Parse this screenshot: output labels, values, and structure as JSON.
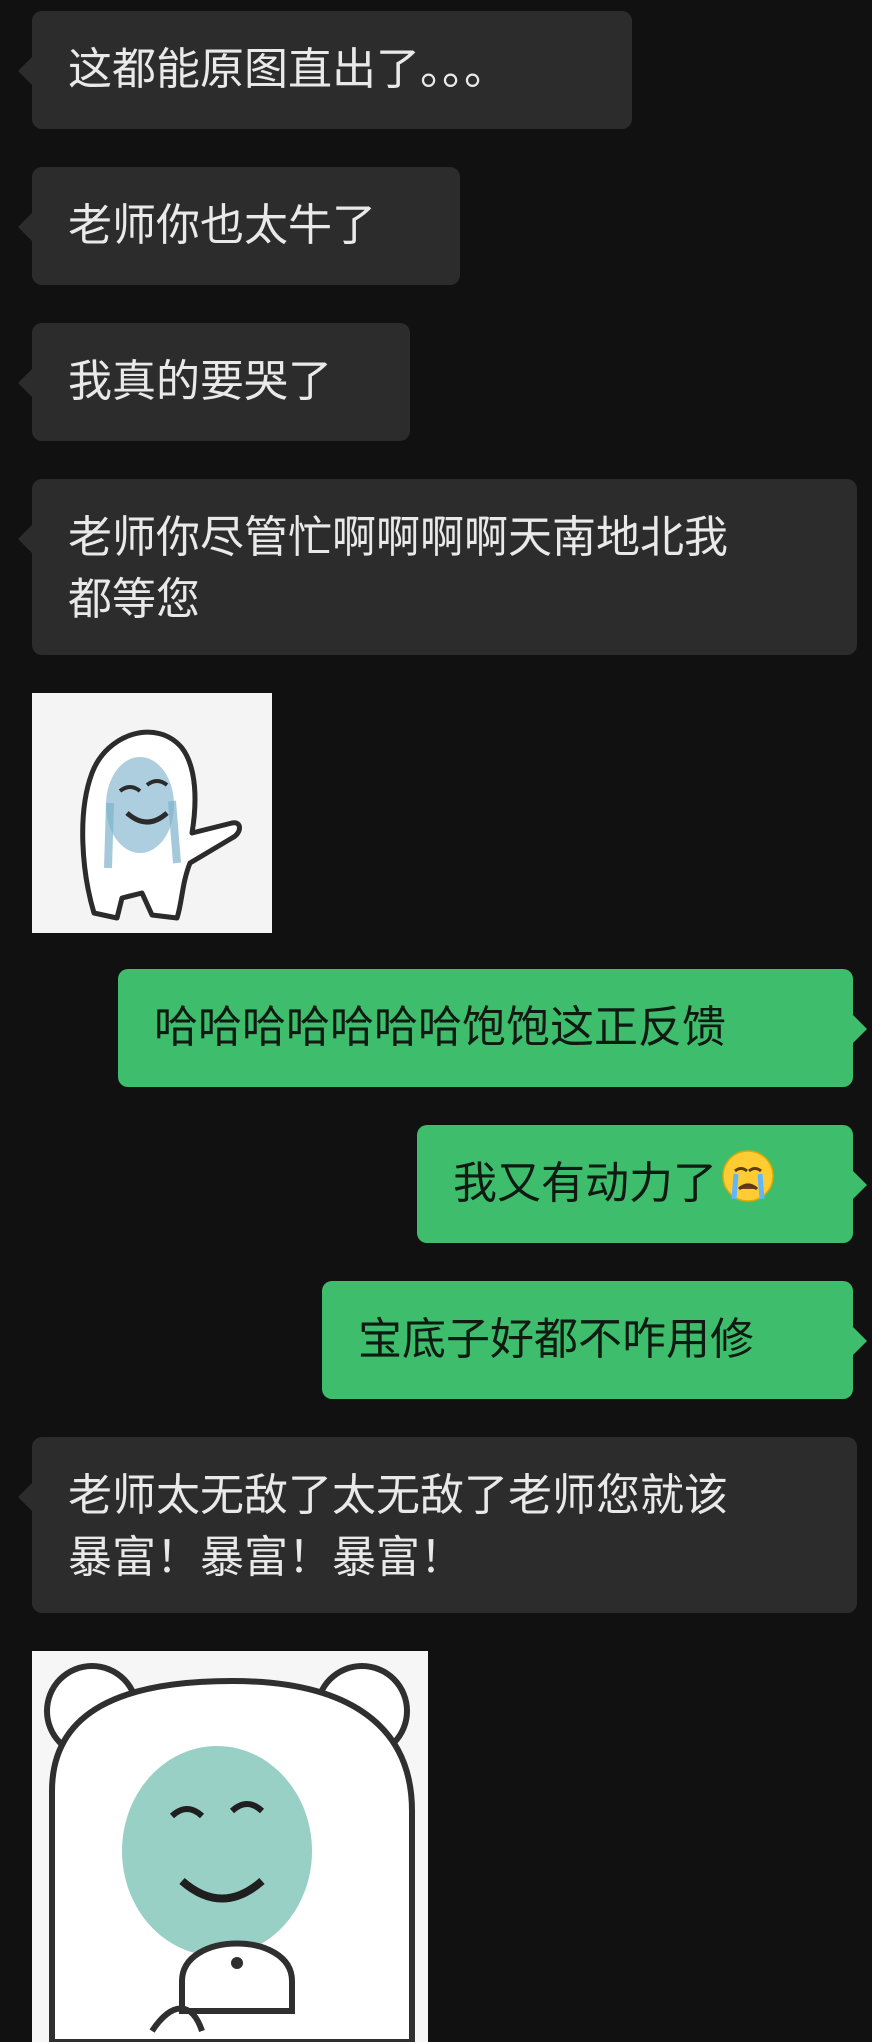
{
  "messages": [
    {
      "side": "left",
      "text": "这都能原图直出了。。。"
    },
    {
      "side": "left",
      "text": "老师你也太牛了"
    },
    {
      "side": "left",
      "text": "我真的要哭了"
    },
    {
      "side": "left",
      "line1": "老师你尽管忙啊啊啊啊天南地北我",
      "line2": "都等您"
    },
    {
      "side": "left",
      "type": "sticker",
      "icon": "crying-ghost-sticker"
    },
    {
      "side": "right",
      "text": "哈哈哈哈哈哈哈饱饱这正反馈"
    },
    {
      "side": "right",
      "text": "我又有动力了",
      "emoji": "crying-face-emoji"
    },
    {
      "side": "right",
      "text": "宝底子好都不咋用修"
    },
    {
      "side": "left",
      "line1": "老师太无敌了太无敌了老师您就该",
      "line2": "暴富！暴富！暴富！"
    },
    {
      "side": "left",
      "type": "sticker",
      "icon": "crying-bear-sticker"
    }
  ],
  "colors": {
    "background": "#111111",
    "incoming": "#2c2c2c",
    "outgoing": "#3ebe6c"
  }
}
